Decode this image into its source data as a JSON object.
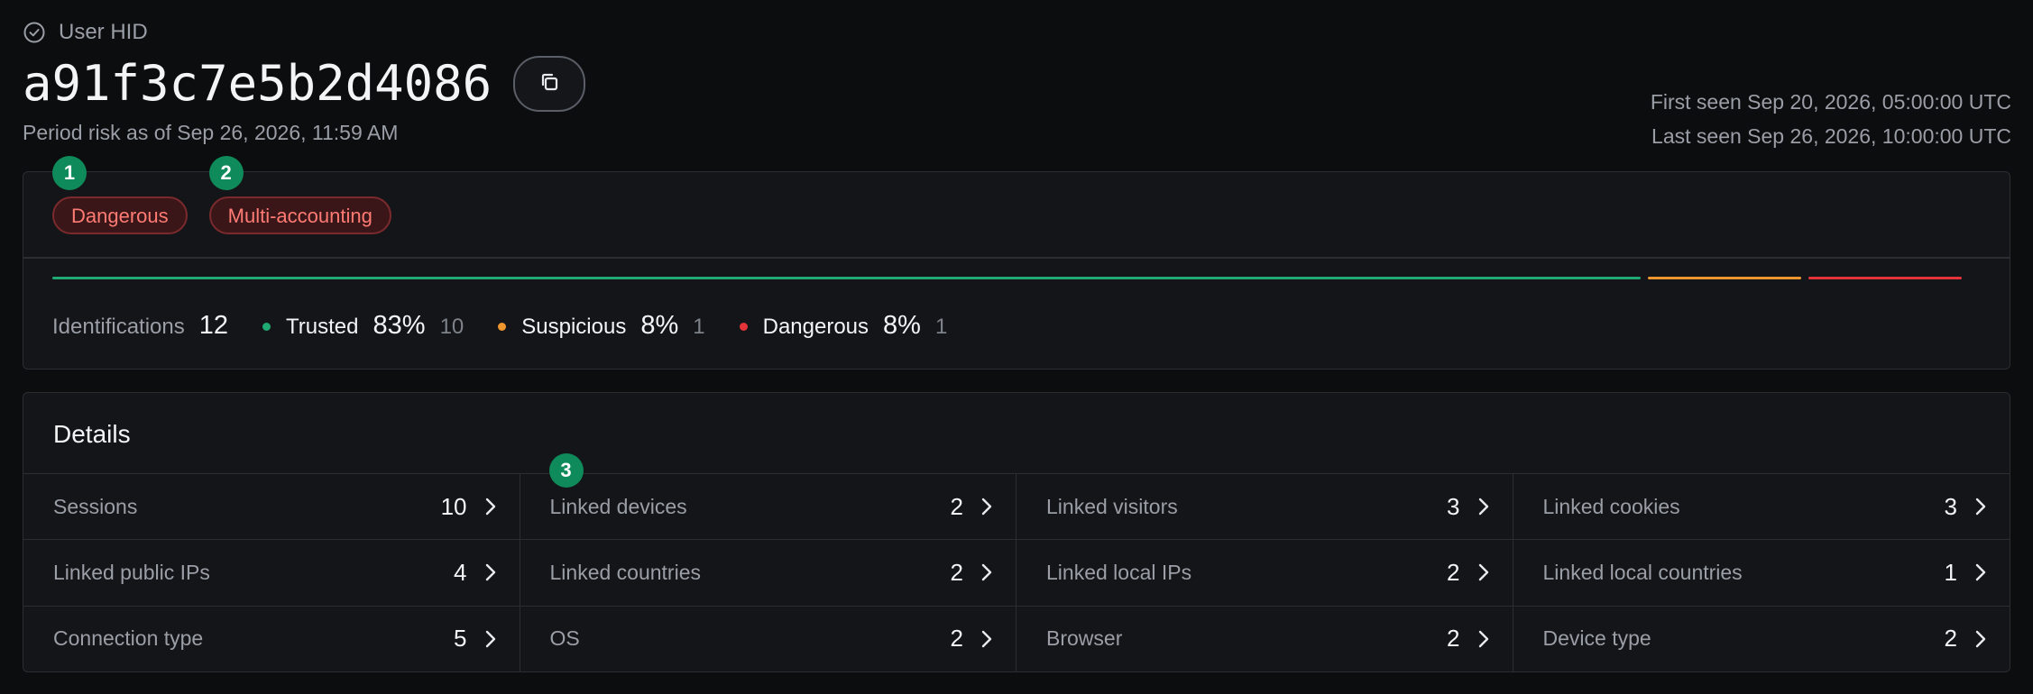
{
  "header": {
    "label": "User HID",
    "hid": "a91f3c7e5b2d4086",
    "period": "Period risk as of Sep 26, 2026, 11:59 AM",
    "first_seen": "First seen Sep 20, 2026, 05:00:00 UTC",
    "last_seen": "Last seen Sep 26, 2026, 10:00:00 UTC"
  },
  "tags": [
    {
      "marker": "1",
      "label": "Dangerous"
    },
    {
      "marker": "2",
      "label": "Multi-accounting"
    }
  ],
  "risk": {
    "identifications_label": "Identifications",
    "identifications_count": "12",
    "categories": [
      {
        "label": "Trusted",
        "percent": "83%",
        "count": "10",
        "fraction": 0.83,
        "color": "#1faa73"
      },
      {
        "label": "Suspicious",
        "percent": "8%",
        "count": "1",
        "fraction": 0.08,
        "color": "#f0962f"
      },
      {
        "label": "Dangerous",
        "percent": "8%",
        "count": "1",
        "fraction": 0.08,
        "color": "#e5333a"
      }
    ]
  },
  "details": {
    "title": "Details",
    "marker": "3",
    "items": [
      {
        "label": "Sessions",
        "value": "10"
      },
      {
        "label": "Linked devices",
        "value": "2"
      },
      {
        "label": "Linked visitors",
        "value": "3"
      },
      {
        "label": "Linked cookies",
        "value": "3"
      },
      {
        "label": "Linked public IPs",
        "value": "4"
      },
      {
        "label": "Linked countries",
        "value": "2"
      },
      {
        "label": "Linked local IPs",
        "value": "2"
      },
      {
        "label": "Linked local countries",
        "value": "1"
      },
      {
        "label": "Connection type",
        "value": "5"
      },
      {
        "label": "OS",
        "value": "2"
      },
      {
        "label": "Browser",
        "value": "2"
      },
      {
        "label": "Device type",
        "value": "2"
      }
    ]
  },
  "icons": {
    "header_icon": "check-circle-icon",
    "copy_icon": "copy-icon",
    "row_icon": "chevron-right-icon"
  },
  "colors": {
    "background": "#0c0d0f",
    "panel": "#141518",
    "marker": "#0f8a5a",
    "tag_text": "#ff7b73"
  }
}
